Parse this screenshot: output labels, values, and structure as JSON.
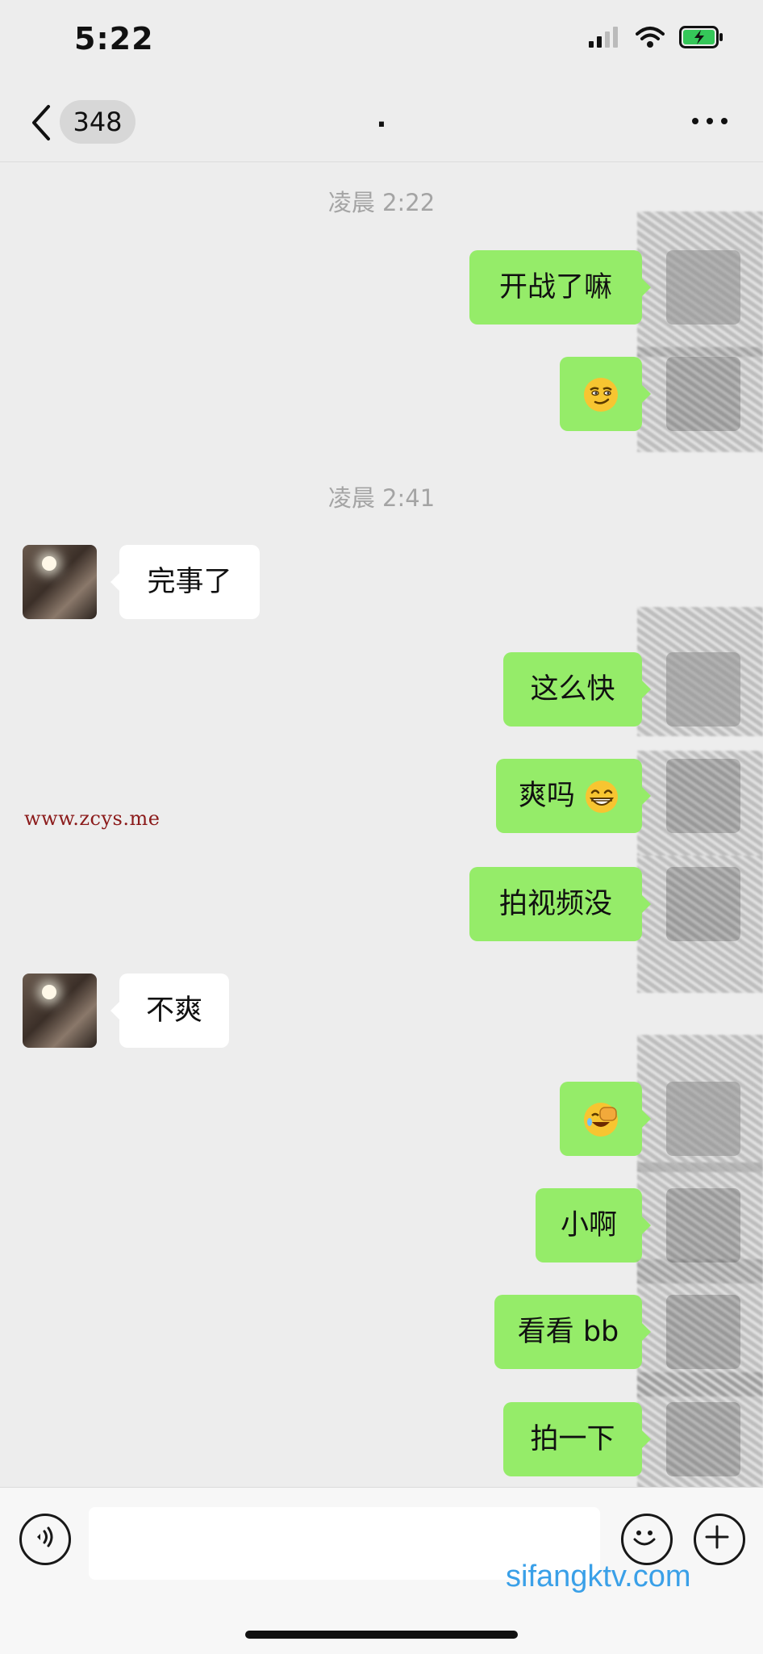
{
  "status_bar": {
    "time": "5:22",
    "icons": [
      "cellular-signal-icon",
      "wifi-icon",
      "battery-charging-icon"
    ]
  },
  "nav": {
    "back_icon": "chevron-left-icon",
    "unread_count": "348",
    "title": ".",
    "more_icon": "ellipsis-icon"
  },
  "timestamps": [
    "凌晨 2:22",
    "凌晨 2:41"
  ],
  "messages": [
    {
      "from": "me",
      "text": "开战了嘛"
    },
    {
      "from": "me",
      "emoji": "smirk-emoji"
    },
    {
      "from": "them",
      "text": "完事了"
    },
    {
      "from": "me",
      "text": "这么快"
    },
    {
      "from": "me",
      "text": "爽吗",
      "emoji": "grin-emoji"
    },
    {
      "from": "me",
      "text": "拍视频没"
    },
    {
      "from": "them",
      "text": "不爽"
    },
    {
      "from": "me",
      "emoji": "facepalm-laugh-emoji"
    },
    {
      "from": "me",
      "text": "小啊"
    },
    {
      "from": "me",
      "text": "看看 bb"
    },
    {
      "from": "me",
      "text": "拍一下"
    }
  ],
  "watermarks": {
    "left": "www.zcys.me",
    "bottom": "sifangktv.com"
  },
  "input_bar": {
    "value": "",
    "icons": [
      "voice-icon",
      "emoji-icon",
      "plus-icon"
    ]
  },
  "colors": {
    "sent_bubble": "#95ec69",
    "received_bubble": "#ffffff",
    "background": "#ededed"
  }
}
